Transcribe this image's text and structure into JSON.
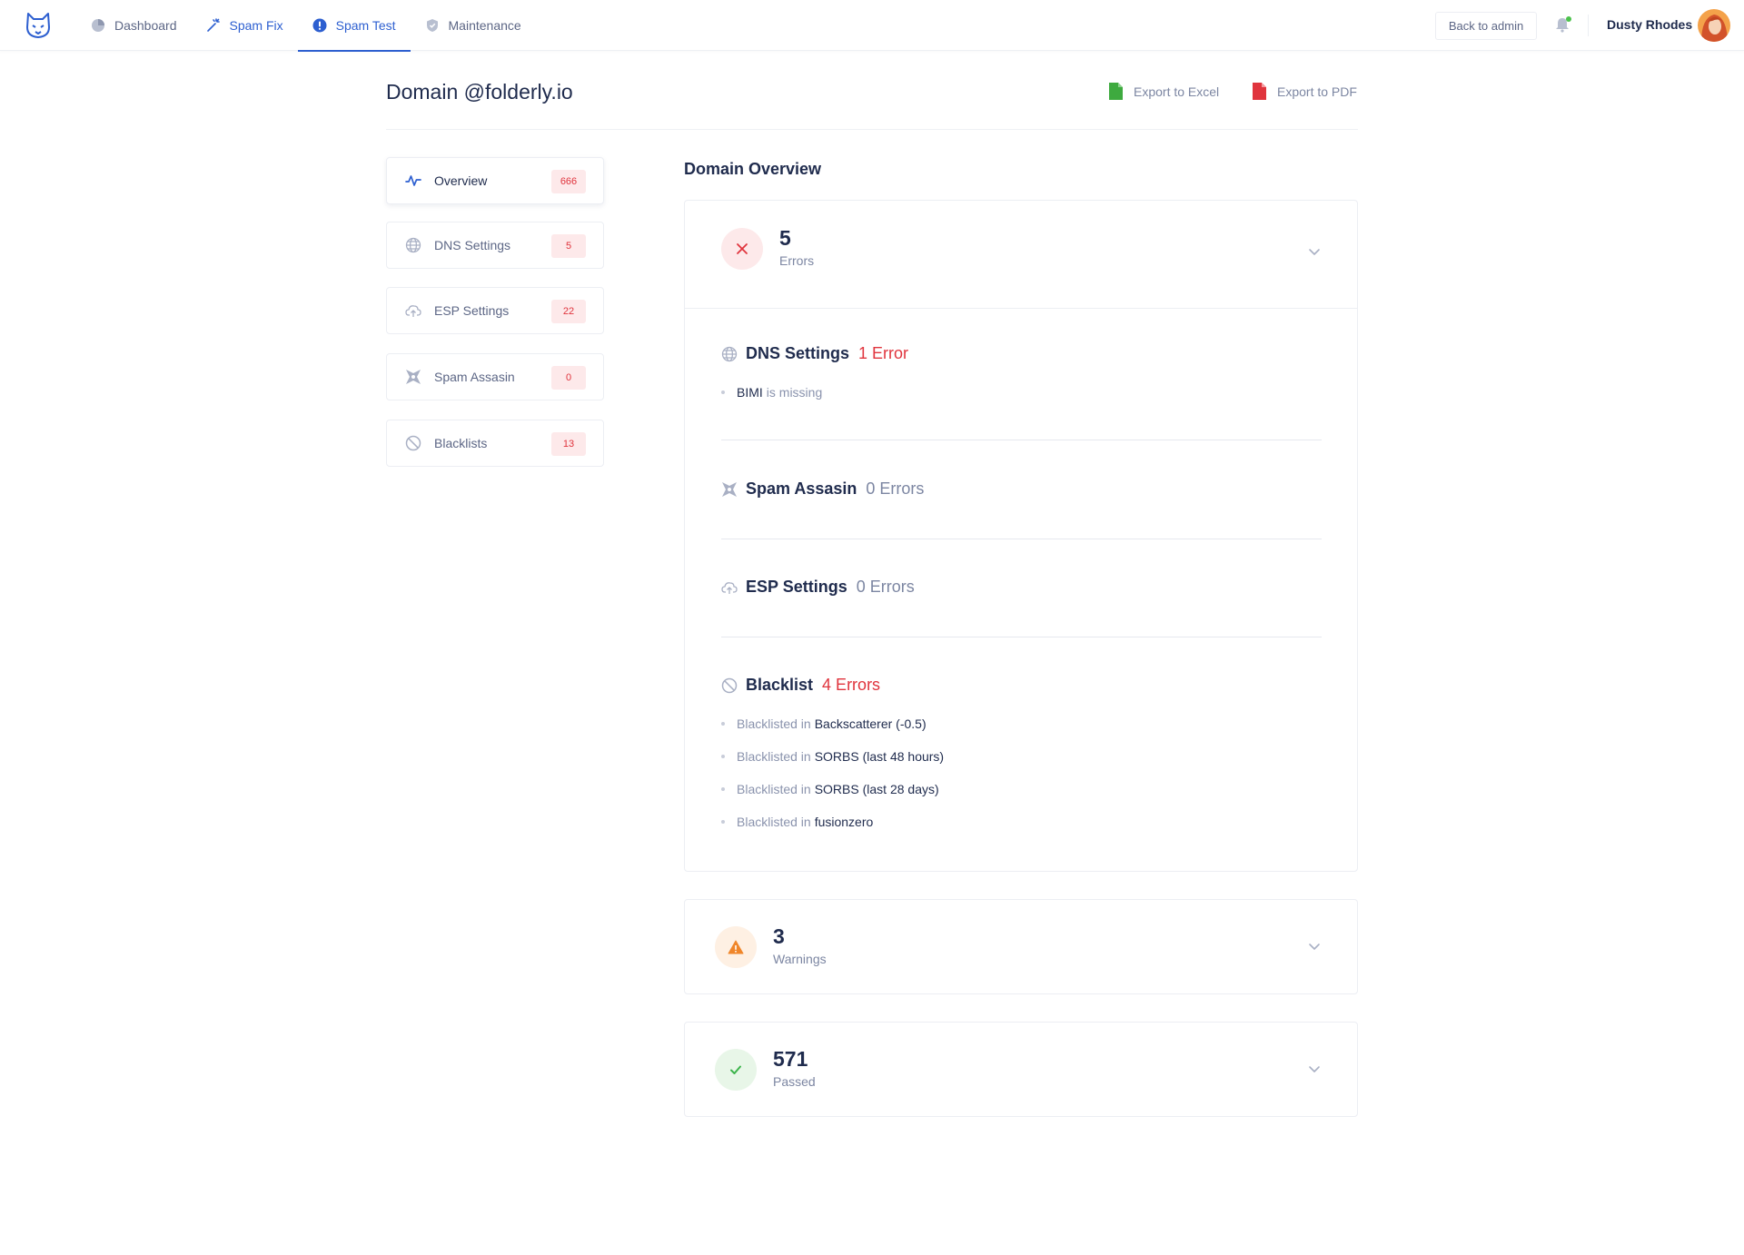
{
  "nav": {
    "items": [
      {
        "label": "Dashboard",
        "icon": "pie-chart-icon"
      },
      {
        "label": "Spam Fix",
        "icon": "magic-wand-icon"
      },
      {
        "label": "Spam Test",
        "icon": "alert-circle-icon"
      },
      {
        "label": "Maintenance",
        "icon": "shield-icon"
      }
    ],
    "active": "Spam Test",
    "back_to_admin": "Back to admin",
    "user_name": "Dusty Rhodes"
  },
  "page": {
    "title": "Domain @folderly.io",
    "export_excel": "Export to Excel",
    "export_pdf": "Export to PDF"
  },
  "menu": {
    "items": [
      {
        "label": "Overview",
        "count": "666",
        "icon": "pulse-icon"
      },
      {
        "label": "DNS Settings",
        "count": "5",
        "icon": "globe-icon"
      },
      {
        "label": "ESP Settings",
        "count": "22",
        "icon": "cloud-upload-icon"
      },
      {
        "label": "Spam Assasin",
        "count": "0",
        "icon": "shuriken-icon"
      },
      {
        "label": "Blacklists",
        "count": "13",
        "icon": "ban-icon"
      }
    ]
  },
  "overview": {
    "title": "Domain Overview",
    "errors": {
      "count": "5",
      "label": "Errors",
      "groups": [
        {
          "title": "DNS Settings",
          "count": "1 Error",
          "items": [
            {
              "strong": "BIMI",
              "rest": "is missing"
            }
          ]
        },
        {
          "title": "Spam Assasin",
          "count": "0 Errors"
        },
        {
          "title": "ESP Settings",
          "count": "0 Errors"
        },
        {
          "title": "Blacklist",
          "count": "4 Errors",
          "items": [
            {
              "prefix": "Blacklisted in",
              "strong": "Backscatterer (-0.5)"
            },
            {
              "prefix": "Blacklisted in",
              "strong": "SORBS (last 48 hours)"
            },
            {
              "prefix": "Blacklisted in",
              "strong": "SORBS (last 28 days)"
            },
            {
              "prefix": "Blacklisted in",
              "strong": "fusionzero"
            }
          ]
        }
      ]
    },
    "warnings": {
      "count": "3",
      "label": "Warnings"
    },
    "passed": {
      "count": "571",
      "label": "Passed"
    }
  },
  "colors": {
    "accent": "#2d5fd0",
    "error": "#e0343d",
    "warning": "#f0862a",
    "success": "#3cb44b",
    "excel": "#3eaa3f",
    "pdf": "#e0343d"
  }
}
